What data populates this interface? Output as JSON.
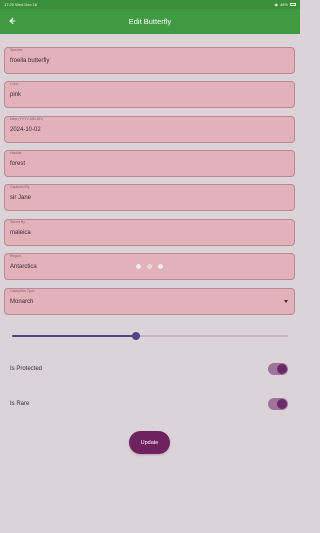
{
  "status_bar": {
    "time": "17:20",
    "date": "Wed Dec 18",
    "battery": "48%"
  },
  "app_bar": {
    "title": "Edit Butterfly"
  },
  "fields": {
    "species": {
      "label": "Species",
      "value": "froella butterfly"
    },
    "color": {
      "label": "Color",
      "value": "pink"
    },
    "date": {
      "label": "Date (YYYY-MM-DD)",
      "value": "2024-10-02"
    },
    "habitat": {
      "label": "Habitat",
      "value": "forest"
    },
    "captured_by": {
      "label": "Captured By",
      "value": "sir Jane"
    },
    "saved_by": {
      "label": "Saved By",
      "value": "maleica"
    },
    "region": {
      "label": "Region",
      "value": "Antarctica"
    },
    "caterpillar_type": {
      "label": "Caterpillar Type",
      "value": "Monarch"
    }
  },
  "slider": {
    "fraction": 0.45,
    "color": "#4d4884"
  },
  "switches": {
    "protected": {
      "label": "Is Protected",
      "on": true
    },
    "rare": {
      "label": "Is Rare",
      "on": true
    }
  },
  "update_button": {
    "label": "Update"
  },
  "colors": {
    "app_bar": "#3f9a42",
    "field_bg": "#e2b1ba",
    "button": "#6e2360"
  }
}
